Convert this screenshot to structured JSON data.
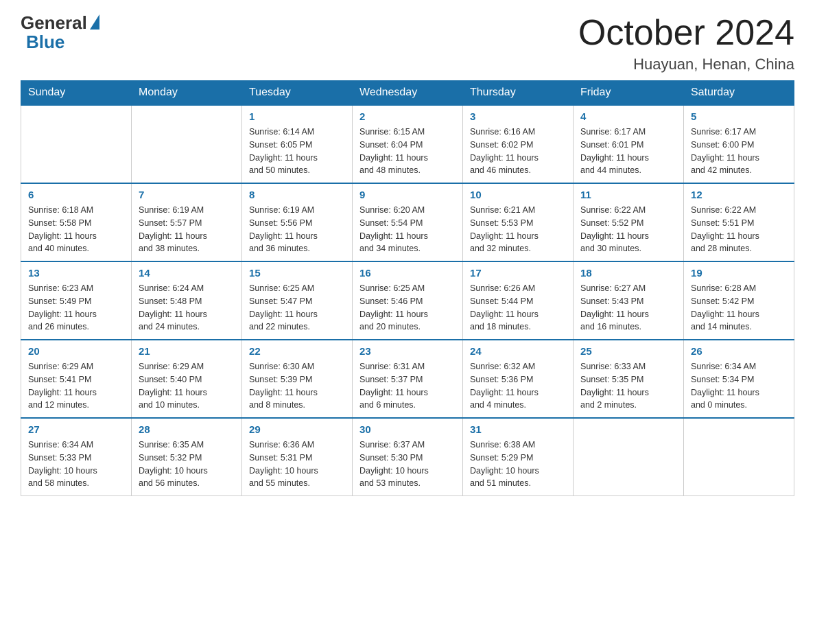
{
  "header": {
    "logo": {
      "general": "General",
      "blue": "Blue"
    },
    "title": "October 2024",
    "location": "Huayuan, Henan, China"
  },
  "weekdays": [
    "Sunday",
    "Monday",
    "Tuesday",
    "Wednesday",
    "Thursday",
    "Friday",
    "Saturday"
  ],
  "weeks": [
    [
      {
        "day": "",
        "info": ""
      },
      {
        "day": "",
        "info": ""
      },
      {
        "day": "1",
        "info": "Sunrise: 6:14 AM\nSunset: 6:05 PM\nDaylight: 11 hours\nand 50 minutes."
      },
      {
        "day": "2",
        "info": "Sunrise: 6:15 AM\nSunset: 6:04 PM\nDaylight: 11 hours\nand 48 minutes."
      },
      {
        "day": "3",
        "info": "Sunrise: 6:16 AM\nSunset: 6:02 PM\nDaylight: 11 hours\nand 46 minutes."
      },
      {
        "day": "4",
        "info": "Sunrise: 6:17 AM\nSunset: 6:01 PM\nDaylight: 11 hours\nand 44 minutes."
      },
      {
        "day": "5",
        "info": "Sunrise: 6:17 AM\nSunset: 6:00 PM\nDaylight: 11 hours\nand 42 minutes."
      }
    ],
    [
      {
        "day": "6",
        "info": "Sunrise: 6:18 AM\nSunset: 5:58 PM\nDaylight: 11 hours\nand 40 minutes."
      },
      {
        "day": "7",
        "info": "Sunrise: 6:19 AM\nSunset: 5:57 PM\nDaylight: 11 hours\nand 38 minutes."
      },
      {
        "day": "8",
        "info": "Sunrise: 6:19 AM\nSunset: 5:56 PM\nDaylight: 11 hours\nand 36 minutes."
      },
      {
        "day": "9",
        "info": "Sunrise: 6:20 AM\nSunset: 5:54 PM\nDaylight: 11 hours\nand 34 minutes."
      },
      {
        "day": "10",
        "info": "Sunrise: 6:21 AM\nSunset: 5:53 PM\nDaylight: 11 hours\nand 32 minutes."
      },
      {
        "day": "11",
        "info": "Sunrise: 6:22 AM\nSunset: 5:52 PM\nDaylight: 11 hours\nand 30 minutes."
      },
      {
        "day": "12",
        "info": "Sunrise: 6:22 AM\nSunset: 5:51 PM\nDaylight: 11 hours\nand 28 minutes."
      }
    ],
    [
      {
        "day": "13",
        "info": "Sunrise: 6:23 AM\nSunset: 5:49 PM\nDaylight: 11 hours\nand 26 minutes."
      },
      {
        "day": "14",
        "info": "Sunrise: 6:24 AM\nSunset: 5:48 PM\nDaylight: 11 hours\nand 24 minutes."
      },
      {
        "day": "15",
        "info": "Sunrise: 6:25 AM\nSunset: 5:47 PM\nDaylight: 11 hours\nand 22 minutes."
      },
      {
        "day": "16",
        "info": "Sunrise: 6:25 AM\nSunset: 5:46 PM\nDaylight: 11 hours\nand 20 minutes."
      },
      {
        "day": "17",
        "info": "Sunrise: 6:26 AM\nSunset: 5:44 PM\nDaylight: 11 hours\nand 18 minutes."
      },
      {
        "day": "18",
        "info": "Sunrise: 6:27 AM\nSunset: 5:43 PM\nDaylight: 11 hours\nand 16 minutes."
      },
      {
        "day": "19",
        "info": "Sunrise: 6:28 AM\nSunset: 5:42 PM\nDaylight: 11 hours\nand 14 minutes."
      }
    ],
    [
      {
        "day": "20",
        "info": "Sunrise: 6:29 AM\nSunset: 5:41 PM\nDaylight: 11 hours\nand 12 minutes."
      },
      {
        "day": "21",
        "info": "Sunrise: 6:29 AM\nSunset: 5:40 PM\nDaylight: 11 hours\nand 10 minutes."
      },
      {
        "day": "22",
        "info": "Sunrise: 6:30 AM\nSunset: 5:39 PM\nDaylight: 11 hours\nand 8 minutes."
      },
      {
        "day": "23",
        "info": "Sunrise: 6:31 AM\nSunset: 5:37 PM\nDaylight: 11 hours\nand 6 minutes."
      },
      {
        "day": "24",
        "info": "Sunrise: 6:32 AM\nSunset: 5:36 PM\nDaylight: 11 hours\nand 4 minutes."
      },
      {
        "day": "25",
        "info": "Sunrise: 6:33 AM\nSunset: 5:35 PM\nDaylight: 11 hours\nand 2 minutes."
      },
      {
        "day": "26",
        "info": "Sunrise: 6:34 AM\nSunset: 5:34 PM\nDaylight: 11 hours\nand 0 minutes."
      }
    ],
    [
      {
        "day": "27",
        "info": "Sunrise: 6:34 AM\nSunset: 5:33 PM\nDaylight: 10 hours\nand 58 minutes."
      },
      {
        "day": "28",
        "info": "Sunrise: 6:35 AM\nSunset: 5:32 PM\nDaylight: 10 hours\nand 56 minutes."
      },
      {
        "day": "29",
        "info": "Sunrise: 6:36 AM\nSunset: 5:31 PM\nDaylight: 10 hours\nand 55 minutes."
      },
      {
        "day": "30",
        "info": "Sunrise: 6:37 AM\nSunset: 5:30 PM\nDaylight: 10 hours\nand 53 minutes."
      },
      {
        "day": "31",
        "info": "Sunrise: 6:38 AM\nSunset: 5:29 PM\nDaylight: 10 hours\nand 51 minutes."
      },
      {
        "day": "",
        "info": ""
      },
      {
        "day": "",
        "info": ""
      }
    ]
  ]
}
